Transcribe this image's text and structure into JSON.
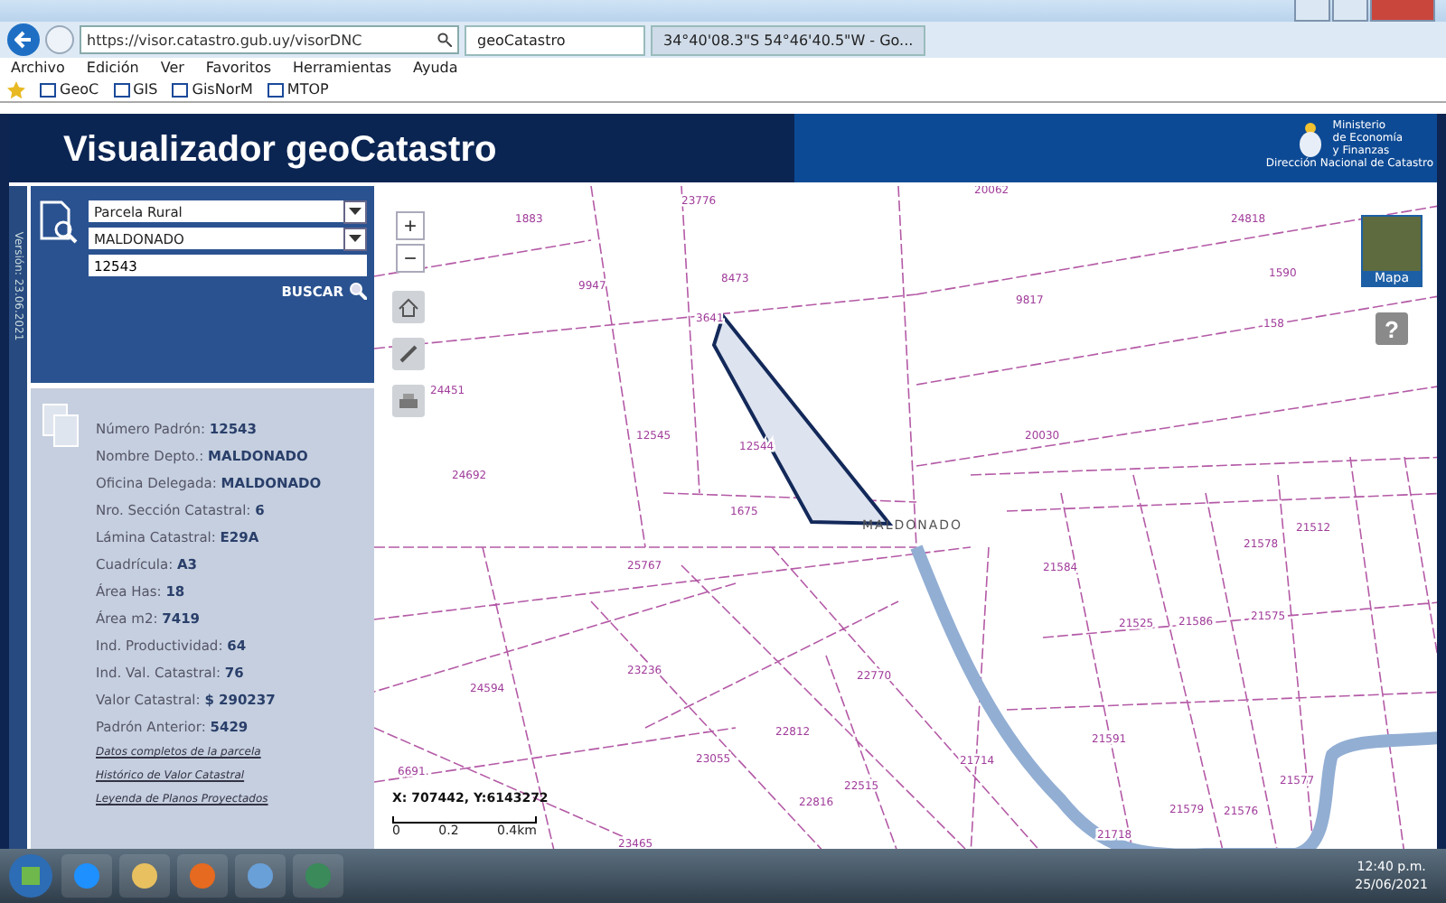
{
  "browser": {
    "address": "https://visor.catastro.gub.uy/visorDNC",
    "tabs": [
      {
        "label": "geoCatastro",
        "selected": true
      },
      {
        "label": "34°40'08.3\"S 54°46'40.5\"W - Go...",
        "selected": false
      }
    ],
    "menu": [
      "Archivo",
      "Edición",
      "Ver",
      "Favoritos",
      "Herramientas",
      "Ayuda"
    ],
    "favorites": [
      "GeoC",
      "GIS",
      "GisNorM",
      "MTOP"
    ]
  },
  "header": {
    "title": "Visualizador geoCatastro",
    "ministry": "Ministerio\nde Economía\ny Finanzas",
    "office": "Dirección Nacional de Catastro"
  },
  "sidebar": {
    "version": "Versión: 23.06.2021",
    "type_select": "Parcela Rural",
    "department_select": "MALDONADO",
    "padron_value": "12543",
    "search_button": "BUSCAR",
    "info": [
      {
        "kind": "field",
        "label": "Número Padrón:",
        "value": "12543"
      },
      {
        "kind": "field",
        "label": "Nombre Depto.:",
        "value": "MALDONADO"
      },
      {
        "kind": "field",
        "label": "Oficina Delegada:",
        "value": "MALDONADO"
      },
      {
        "kind": "field",
        "label": "Nro. Sección Catastral:",
        "value": "6"
      },
      {
        "kind": "field",
        "label": "Lámina Catastral:",
        "value": "E29A"
      },
      {
        "kind": "field",
        "label": "Cuadrícula:",
        "value": "A3"
      },
      {
        "kind": "field",
        "label": "Área Has:",
        "value": "18"
      },
      {
        "kind": "field",
        "label": "Área m2:",
        "value": "7419"
      },
      {
        "kind": "field",
        "label": "Ind. Productividad:",
        "value": "64"
      },
      {
        "kind": "field",
        "label": "Ind. Val. Catastral:",
        "value": "76"
      },
      {
        "kind": "field",
        "label": "Valor Catastral:",
        "value": "$ 290237"
      },
      {
        "kind": "field",
        "label": "Padrón Anterior:",
        "value": "5429"
      },
      {
        "kind": "link",
        "label": "Datos completos de la parcela"
      },
      {
        "kind": "link",
        "label": "Histórico de Valor Catastral"
      },
      {
        "kind": "link",
        "label": "Leyenda de Planos Proyectados"
      }
    ]
  },
  "map": {
    "place_label": "MALDONADO",
    "thumbnail_label": "Mapa",
    "help": "?",
    "zoom_in": "+",
    "zoom_out": "−",
    "coordinates": "X: 707442, Y:6143272",
    "scale_ticks": [
      "0",
      "0.2",
      "0.4km"
    ],
    "parcel_labels": [
      "23776",
      "1883",
      "9947",
      "8473",
      "3641",
      "24818",
      "1590",
      "158",
      "20062",
      "9817",
      "24451",
      "12545",
      "12544",
      "24692",
      "1675",
      "25767",
      "20030",
      "21584",
      "21525",
      "21586",
      "21578",
      "21575",
      "21512",
      "24594",
      "23236",
      "22770",
      "22812",
      "23055",
      "21591",
      "21577",
      "21579",
      "21576",
      "21718",
      "23465",
      "6691",
      "22816",
      "22515",
      "21714"
    ]
  },
  "taskbar": {
    "time": "12:40 p.m.",
    "date": "25/06/2021"
  }
}
